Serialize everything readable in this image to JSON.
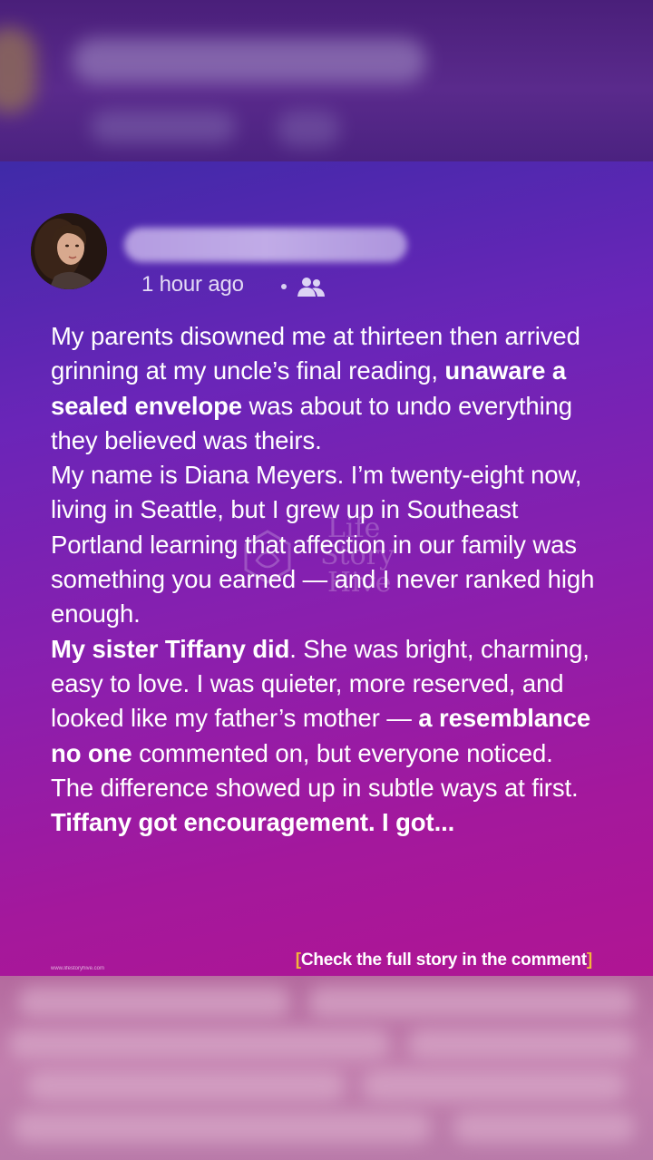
{
  "post": {
    "time_label": "1 hour ago",
    "audience_icon": "friends-icon",
    "author_avatar": "avatar",
    "paragraphs": [
      [
        {
          "text": "My parents disowned me at thirteen then arrived grinning at my uncle’s final reading, ",
          "bold": false
        },
        {
          "text": "unaware a sealed envelope",
          "bold": true
        },
        {
          "text": " was about to undo everything they believed was theirs.",
          "bold": false
        }
      ],
      [
        {
          "text": "My name is Diana Meyers. I’m twenty-eight now, living in Seattle, but I grew up in Southeast Portland learning that affection in our family was something you earned — and I never ranked high enough.",
          "bold": false
        }
      ],
      [
        {
          "text": "My sister Tiffany did",
          "bold": true
        },
        {
          "text": ". She was bright, charming, easy to love. I was quieter, more reserved, and looked like my father’s mother — ",
          "bold": false
        },
        {
          "text": "a resemblance no one",
          "bold": true
        },
        {
          "text": " commented on, but everyone noticed.",
          "bold": false
        }
      ],
      [
        {
          "text": "The difference showed up in subtle ways at first. ",
          "bold": false
        },
        {
          "text": "Tiffany got encouragement. I got...",
          "bold": true
        }
      ]
    ]
  },
  "watermark": {
    "line1": "Life",
    "line2": "Story",
    "line3": "Hive"
  },
  "footer": {
    "site_url": "www.lifestoryhive.com",
    "cta_open": "[",
    "cta_text": "Check the full story in the comment",
    "cta_close": "]"
  },
  "colors": {
    "cta_bracket": "#f2b53a",
    "card_top": "#3f2aa8",
    "card_bottom": "#b01593"
  }
}
